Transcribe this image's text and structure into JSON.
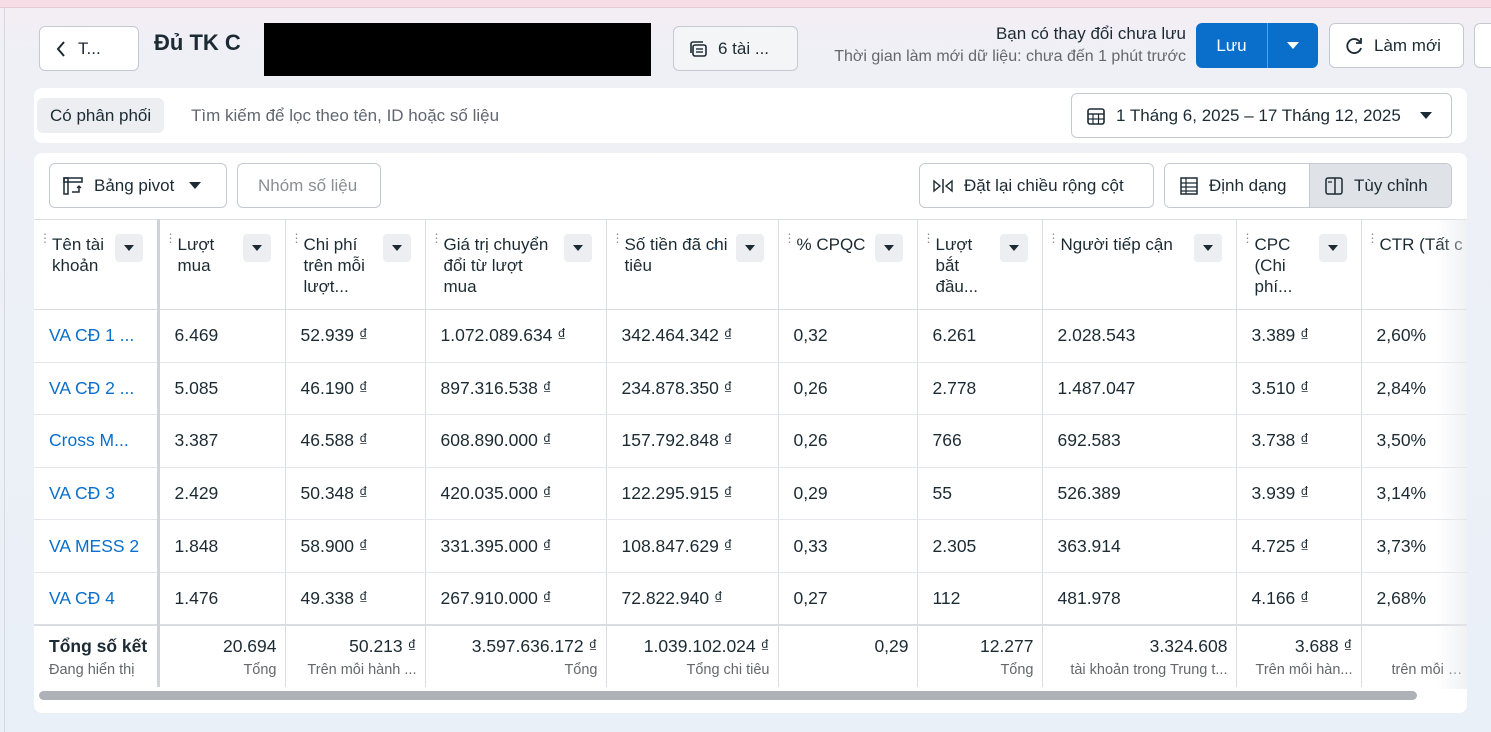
{
  "header": {
    "back_label": "T...",
    "title": "Đủ TK C",
    "accounts_label": "6 tài ...",
    "unsaved_line1": "Bạn có thay đổi chưa lưu",
    "unsaved_line2": "Thời gian làm mới dữ liệu: chưa đến 1 phút trước",
    "save_label": "Lưu",
    "refresh_label": "Làm mới"
  },
  "filter": {
    "chip_label": "Có phân phối",
    "search_placeholder": "Tìm kiếm để lọc theo tên, ID hoặc số liệu",
    "date_range": "1 Tháng 6, 2025 – 17 Tháng 12, 2025"
  },
  "toolbar": {
    "pivot_label": "Bảng pivot",
    "group_label": "Nhóm số liệu",
    "reset_label": "Đặt lại chiều rộng cột",
    "format_label": "Định dạng",
    "custom_label": "Tùy chỉnh"
  },
  "table": {
    "columns": [
      "Tên tài khoản",
      "Lượt mua",
      "Chi phí trên mỗi lượt...",
      "Giá trị chuyển đổi từ lượt mua",
      "Số tiền đã chi tiêu",
      "% CPQC",
      "Lượt bắt đầu...",
      "Người tiếp cận",
      "CPC (Chi phí...",
      "CTR (Tất c"
    ],
    "rows": [
      [
        "VA CĐ 1 ...",
        "6.469",
        "52.939 ₫",
        "1.072.089.634 ₫",
        "342.464.342 ₫",
        "0,32",
        "6.261",
        "2.028.543",
        "3.389 ₫",
        "2,60%"
      ],
      [
        "VA CĐ 2 ...",
        "5.085",
        "46.190 ₫",
        "897.316.538 ₫",
        "234.878.350 ₫",
        "0,26",
        "2.778",
        "1.487.047",
        "3.510 ₫",
        "2,84%"
      ],
      [
        "Cross M...",
        "3.387",
        "46.588 ₫",
        "608.890.000 ₫",
        "157.792.848 ₫",
        "0,26",
        "766",
        "692.583",
        "3.738 ₫",
        "3,50%"
      ],
      [
        "VA CĐ 3",
        "2.429",
        "50.348 ₫",
        "420.035.000 ₫",
        "122.295.915 ₫",
        "0,29",
        "55",
        "526.389",
        "3.939 ₫",
        "3,14%"
      ],
      [
        "VA MESS 2",
        "1.848",
        "58.900 ₫",
        "331.395.000 ₫",
        "108.847.629 ₫",
        "0,33",
        "2.305",
        "363.914",
        "4.725 ₫",
        "3,73%"
      ],
      [
        "VA CĐ 4",
        "1.476",
        "49.338 ₫",
        "267.910.000 ₫",
        "72.822.940 ₫",
        "0,27",
        "112",
        "481.978",
        "4.166 ₫",
        "2,68%"
      ]
    ],
    "totals": [
      {
        "value": "Tổng số kết",
        "sub": "Đang hiển thị "
      },
      {
        "value": "20.694",
        "sub": "Tổng"
      },
      {
        "value": "50.213 ₫",
        "sub": "Trên mỗi hành ..."
      },
      {
        "value": "3.597.636.172 ₫",
        "sub": "Tổng"
      },
      {
        "value": "1.039.102.024 ₫",
        "sub": "Tổng chi tiêu"
      },
      {
        "value": "0,29",
        "sub": ""
      },
      {
        "value": "12.277",
        "sub": "Tổng"
      },
      {
        "value": "3.324.608",
        "sub": "tài khoản trong Trung t..."
      },
      {
        "value": "3.688 ₫",
        "sub": "Trên mỗi hàn..."
      },
      {
        "value": "",
        "sub": "trên mỗi lần"
      }
    ]
  },
  "colors": {
    "accent": "#0a6fcb",
    "text": "#1c2b33",
    "muted": "#65676b"
  }
}
